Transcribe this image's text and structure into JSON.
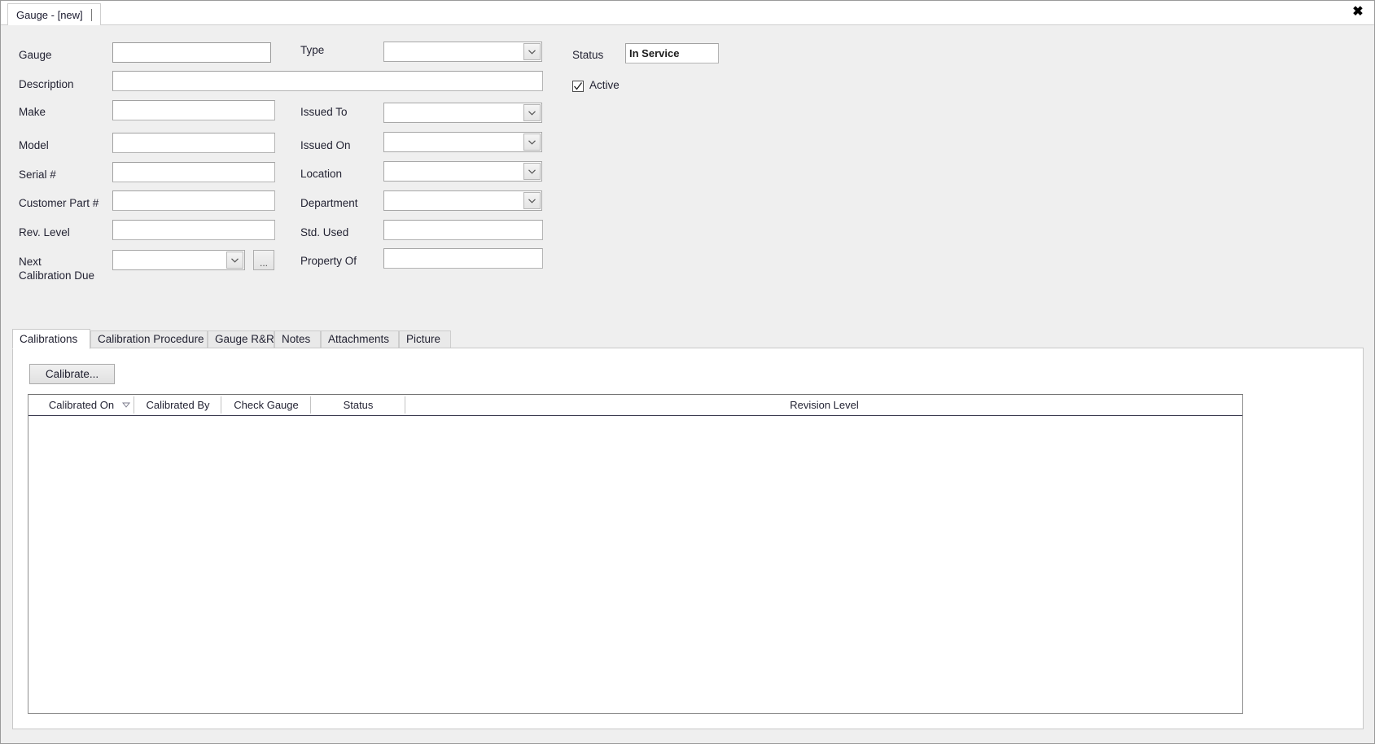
{
  "window": {
    "tab_title": "Gauge - [new]",
    "close_icon": "close-icon"
  },
  "form": {
    "left_column": [
      {
        "label": "Gauge",
        "value": "",
        "control": "textbox",
        "focused": true
      },
      {
        "label": "Description",
        "value": "",
        "control": "textbox"
      },
      {
        "label": "Make",
        "value": "",
        "control": "textbox"
      },
      {
        "label": "Model",
        "value": "",
        "control": "textbox"
      },
      {
        "label": "Serial #",
        "value": "",
        "control": "textbox"
      },
      {
        "label": "Customer Part #",
        "value": "",
        "control": "textbox"
      },
      {
        "label": "Rev. Level",
        "value": "",
        "control": "textbox"
      },
      {
        "label_line1": "Next",
        "label_line2": "Calibration Due",
        "value": "",
        "control": "combobox",
        "has_ellipsis_button": true,
        "ellipsis_label": "..."
      }
    ],
    "middle_column": [
      {
        "label": "Type",
        "value": "",
        "control": "combobox"
      },
      {
        "label": "Issued To",
        "value": "",
        "control": "combobox"
      },
      {
        "label": "Issued On",
        "value": "",
        "control": "combobox"
      },
      {
        "label": "Location",
        "value": "",
        "control": "combobox"
      },
      {
        "label": "Department",
        "value": "",
        "control": "combobox"
      },
      {
        "label": "Std. Used",
        "value": "",
        "control": "textbox"
      },
      {
        "label": "Property Of",
        "value": "",
        "control": "textbox"
      }
    ],
    "right_column": {
      "status_label": "Status",
      "status_value": "In Service",
      "active_label": "Active",
      "active_checked": true
    }
  },
  "tabs": [
    {
      "label": "Calibrations",
      "active": true
    },
    {
      "label": "Calibration Procedure",
      "active": false
    },
    {
      "label": "Gauge R&R",
      "active": false
    },
    {
      "label": "Notes",
      "active": false
    },
    {
      "label": "Attachments",
      "active": false
    },
    {
      "label": "Picture",
      "active": false
    }
  ],
  "calibrations_tab": {
    "calibrate_button": "Calibrate...",
    "grid": {
      "columns": [
        {
          "label": "Calibrated On",
          "sorted": true,
          "sort_direction": "descending"
        },
        {
          "label": "Calibrated By",
          "sorted": false
        },
        {
          "label": "Check Gauge",
          "sorted": false
        },
        {
          "label": "Status",
          "sorted": false
        },
        {
          "label": "Revision Level",
          "sorted": false
        }
      ],
      "rows": [],
      "row_count": 0
    }
  },
  "colors": {
    "window_background": "#efefef",
    "panel_background": "#ffffff",
    "field_border": "#b4b4b4",
    "grid_header_rule": "#3b3b4f",
    "text": "#232333"
  }
}
